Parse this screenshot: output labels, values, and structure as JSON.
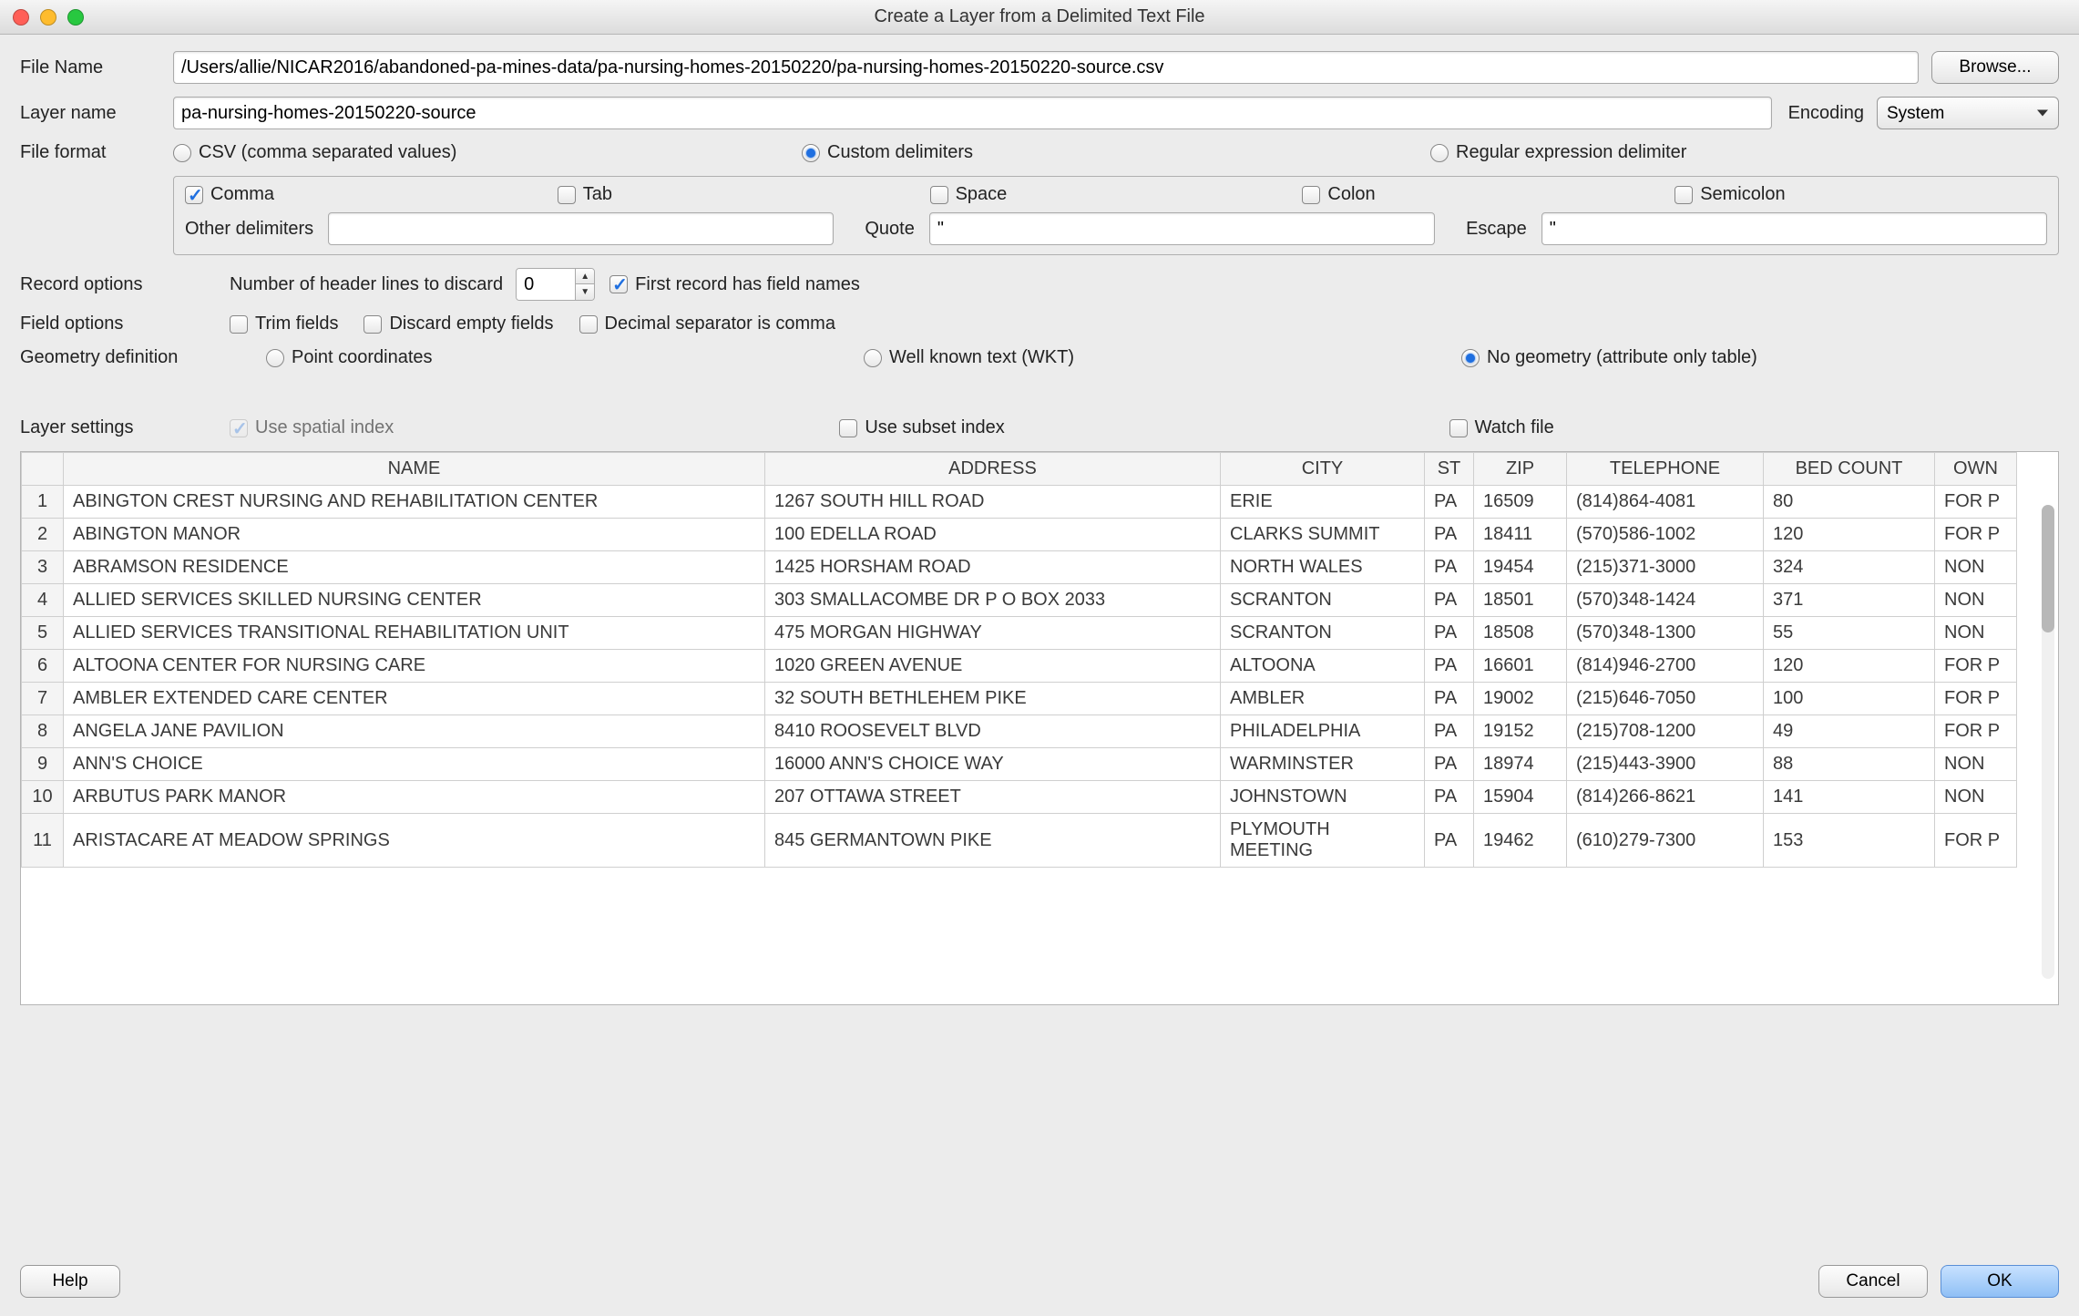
{
  "window": {
    "title": "Create a Layer from a Delimited Text File"
  },
  "labels": {
    "file_name": "File Name",
    "browse": "Browse...",
    "layer_name": "Layer name",
    "encoding": "Encoding",
    "file_format": "File format",
    "record_options": "Record options",
    "field_options": "Field options",
    "geometry_definition": "Geometry definition",
    "layer_settings": "Layer settings",
    "header_lines": "Number of header lines to discard",
    "first_record": "First record has field names",
    "help": "Help",
    "cancel": "Cancel",
    "ok": "OK"
  },
  "file_name_value": "/Users/allie/NICAR2016/abandoned-pa-mines-data/pa-nursing-homes-20150220/pa-nursing-homes-20150220-source.csv",
  "layer_name_value": "pa-nursing-homes-20150220-source",
  "encoding_value": "System",
  "file_format": {
    "csv": "CSV (comma separated values)",
    "custom": "Custom delimiters",
    "regex": "Regular expression delimiter"
  },
  "delimiters": {
    "comma": "Comma",
    "tab": "Tab",
    "space": "Space",
    "colon": "Colon",
    "semicolon": "Semicolon",
    "other_label": "Other delimiters",
    "other_value": "",
    "quote_label": "Quote",
    "quote_value": "\"",
    "escape_label": "Escape",
    "escape_value": "\""
  },
  "record": {
    "header_lines_value": "0"
  },
  "field": {
    "trim": "Trim fields",
    "discard": "Discard empty fields",
    "decimal": "Decimal separator is comma"
  },
  "geometry": {
    "point": "Point coordinates",
    "wkt": "Well known text (WKT)",
    "none": "No geometry (attribute only table)"
  },
  "layer_settings": {
    "spatial": "Use spatial index",
    "subset": "Use subset index",
    "watch": "Watch file"
  },
  "table": {
    "headers": {
      "name": "NAME",
      "address": "ADDRESS",
      "city": "CITY",
      "st": "ST",
      "zip": "ZIP",
      "tel": "TELEPHONE",
      "bed": "BED COUNT",
      "own": "OWN"
    },
    "rows": [
      {
        "n": "1",
        "name": "ABINGTON CREST NURSING AND REHABILITATION CENTER",
        "addr": "1267 SOUTH HILL ROAD",
        "city": "ERIE",
        "st": "PA",
        "zip": "16509",
        "tel": "(814)864-4081",
        "bed": "80",
        "own": "FOR P"
      },
      {
        "n": "2",
        "name": "ABINGTON MANOR",
        "addr": "100 EDELLA ROAD",
        "city": "CLARKS SUMMIT",
        "st": "PA",
        "zip": "18411",
        "tel": "(570)586-1002",
        "bed": "120",
        "own": "FOR P"
      },
      {
        "n": "3",
        "name": "ABRAMSON RESIDENCE",
        "addr": "1425 HORSHAM ROAD",
        "city": "NORTH WALES",
        "st": "PA",
        "zip": "19454",
        "tel": "(215)371-3000",
        "bed": "324",
        "own": "NON"
      },
      {
        "n": "4",
        "name": "ALLIED SERVICES SKILLED NURSING CENTER",
        "addr": "303 SMALLACOMBE DR  P O BOX 2033",
        "city": "SCRANTON",
        "st": "PA",
        "zip": "18501",
        "tel": "(570)348-1424",
        "bed": "371",
        "own": "NON"
      },
      {
        "n": "5",
        "name": "ALLIED SERVICES TRANSITIONAL REHABILITATION UNIT",
        "addr": "475 MORGAN HIGHWAY",
        "city": "SCRANTON",
        "st": "PA",
        "zip": "18508",
        "tel": "(570)348-1300",
        "bed": "55",
        "own": "NON"
      },
      {
        "n": "6",
        "name": "ALTOONA CENTER FOR NURSING CARE",
        "addr": "1020 GREEN AVENUE",
        "city": "ALTOONA",
        "st": "PA",
        "zip": "16601",
        "tel": "(814)946-2700",
        "bed": "120",
        "own": "FOR P"
      },
      {
        "n": "7",
        "name": "AMBLER EXTENDED CARE CENTER",
        "addr": "32 SOUTH BETHLEHEM PIKE",
        "city": "AMBLER",
        "st": "PA",
        "zip": "19002",
        "tel": "(215)646-7050",
        "bed": "100",
        "own": "FOR P"
      },
      {
        "n": "8",
        "name": "ANGELA JANE PAVILION",
        "addr": "8410 ROOSEVELT BLVD",
        "city": "PHILADELPHIA",
        "st": "PA",
        "zip": "19152",
        "tel": "(215)708-1200",
        "bed": "49",
        "own": "FOR P"
      },
      {
        "n": "9",
        "name": "ANN'S CHOICE",
        "addr": "16000 ANN'S CHOICE WAY",
        "city": "WARMINSTER",
        "st": "PA",
        "zip": "18974",
        "tel": "(215)443-3900",
        "bed": "88",
        "own": "NON"
      },
      {
        "n": "10",
        "name": "ARBUTUS PARK MANOR",
        "addr": "207 OTTAWA STREET",
        "city": "JOHNSTOWN",
        "st": "PA",
        "zip": "15904",
        "tel": "(814)266-8621",
        "bed": "141",
        "own": "NON"
      },
      {
        "n": "11",
        "name": "ARISTACARE AT MEADOW SPRINGS",
        "addr": "845 GERMANTOWN PIKE",
        "city": "PLYMOUTH MEETING",
        "st": "PA",
        "zip": "19462",
        "tel": "(610)279-7300",
        "bed": "153",
        "own": "FOR P"
      }
    ]
  }
}
